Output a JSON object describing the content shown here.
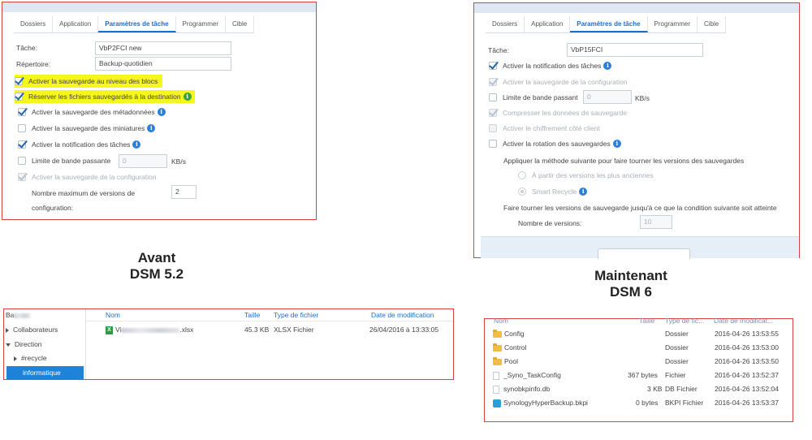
{
  "left_panel": {
    "tabs": [
      "Dossiers",
      "Application",
      "Paramètres de tâche",
      "Programmer",
      "Cible"
    ],
    "active_tab": 2,
    "task_label": "Tâche:",
    "task_value": "VbP2FCI new",
    "dir_label": "Répertoire:",
    "dir_value": "Backup-quotidien",
    "options": [
      "Activer la sauvegarde au niveau des blocs",
      "Réserver les fichiers sauvegardés à la destination",
      "Activer la sauvegarde des métadonnées",
      "Activer la sauvegarde des miniatures",
      "Activer la notification des tâches",
      "Limite de bande passante",
      "Activer la sauvegarde de la configuration"
    ],
    "bandwidth_value": "0",
    "bandwidth_unit": "KB/s",
    "max_versions_label_1": "Nombre maximum de versions de",
    "max_versions_label_2": "configuration:",
    "max_versions_value": "2"
  },
  "right_panel": {
    "tabs": [
      "Dossiers",
      "Application",
      "Paramètres de tâche",
      "Programmer",
      "Cible"
    ],
    "active_tab": 2,
    "task_label": "Tâche:",
    "task_value": "VbP15FCI",
    "options": [
      "Activer la notification des tâches",
      "Activer la sauvegarde de la configuration",
      "Limite de bande passant",
      "Compresser les données de sauvegarde",
      "Activer le chiffrement côté client",
      "Activer la rotation des sauvegardes"
    ],
    "bandwidth_value": "0",
    "bandwidth_unit": "KB/s",
    "rotation_text": "Appliquer la méthode suivante pour faire tourner les versions des sauvegardes",
    "radio_1": "À partir des versions les plus anciennes",
    "radio_2": "Smart Recycle",
    "rotate_until": "Faire tourner les versions de sauvegarde jusqu'à ce que la condition suivante soit atteinte",
    "versions_label": "Nombre de versions:",
    "versions_value": "10"
  },
  "captions": {
    "before_1": "Avant",
    "before_2": "DSM 5.2",
    "now_1": "Maintenant",
    "now_2": "DSM 6"
  },
  "left_files": {
    "tree": [
      "Ba",
      "Collaborateurs",
      "Direction",
      "#recycle",
      "informatique"
    ],
    "headers": [
      "Nom",
      "Taille",
      "Type de fichier",
      "Date de modification"
    ],
    "rows": [
      {
        "name_prefix": "Vi",
        "name_suffix": ".xlsx",
        "size": "45.3 KB",
        "type": "XLSX Fichier",
        "date": "26/04/2016 à 13:33:05"
      }
    ]
  },
  "right_files": {
    "headers": [
      "Nom",
      "Taille",
      "Type de fic...",
      "Date de modificat..."
    ],
    "rows": [
      {
        "name": "Config",
        "size": "",
        "type": "Dossier",
        "date": "2016-04-26 13:53:55",
        "icon": "folder"
      },
      {
        "name": "Control",
        "size": "",
        "type": "Dossier",
        "date": "2016-04-26 13:53:00",
        "icon": "folder"
      },
      {
        "name": "Pool",
        "size": "",
        "type": "Dossier",
        "date": "2016-04-26 13:53:50",
        "icon": "folder"
      },
      {
        "name": "_Syno_TaskConfig",
        "size": "367 bytes",
        "type": "Fichier",
        "date": "2016-04-26 13:52:37",
        "icon": "doc"
      },
      {
        "name": "synobkpinfo.db",
        "size": "3 KB",
        "type": "DB Fichier",
        "date": "2016-04-26 13:52:04",
        "icon": "doc"
      },
      {
        "name": "SynologyHyperBackup.bkpi",
        "size": "0 bytes",
        "type": "BKPI Fichier",
        "date": "2016-04-26 13:53:37",
        "icon": "pkg"
      }
    ]
  },
  "colors": {
    "accent": "#1e6fc8",
    "border": "#d94040",
    "highlight": "#f6f51c",
    "info": "#2a80d8"
  }
}
